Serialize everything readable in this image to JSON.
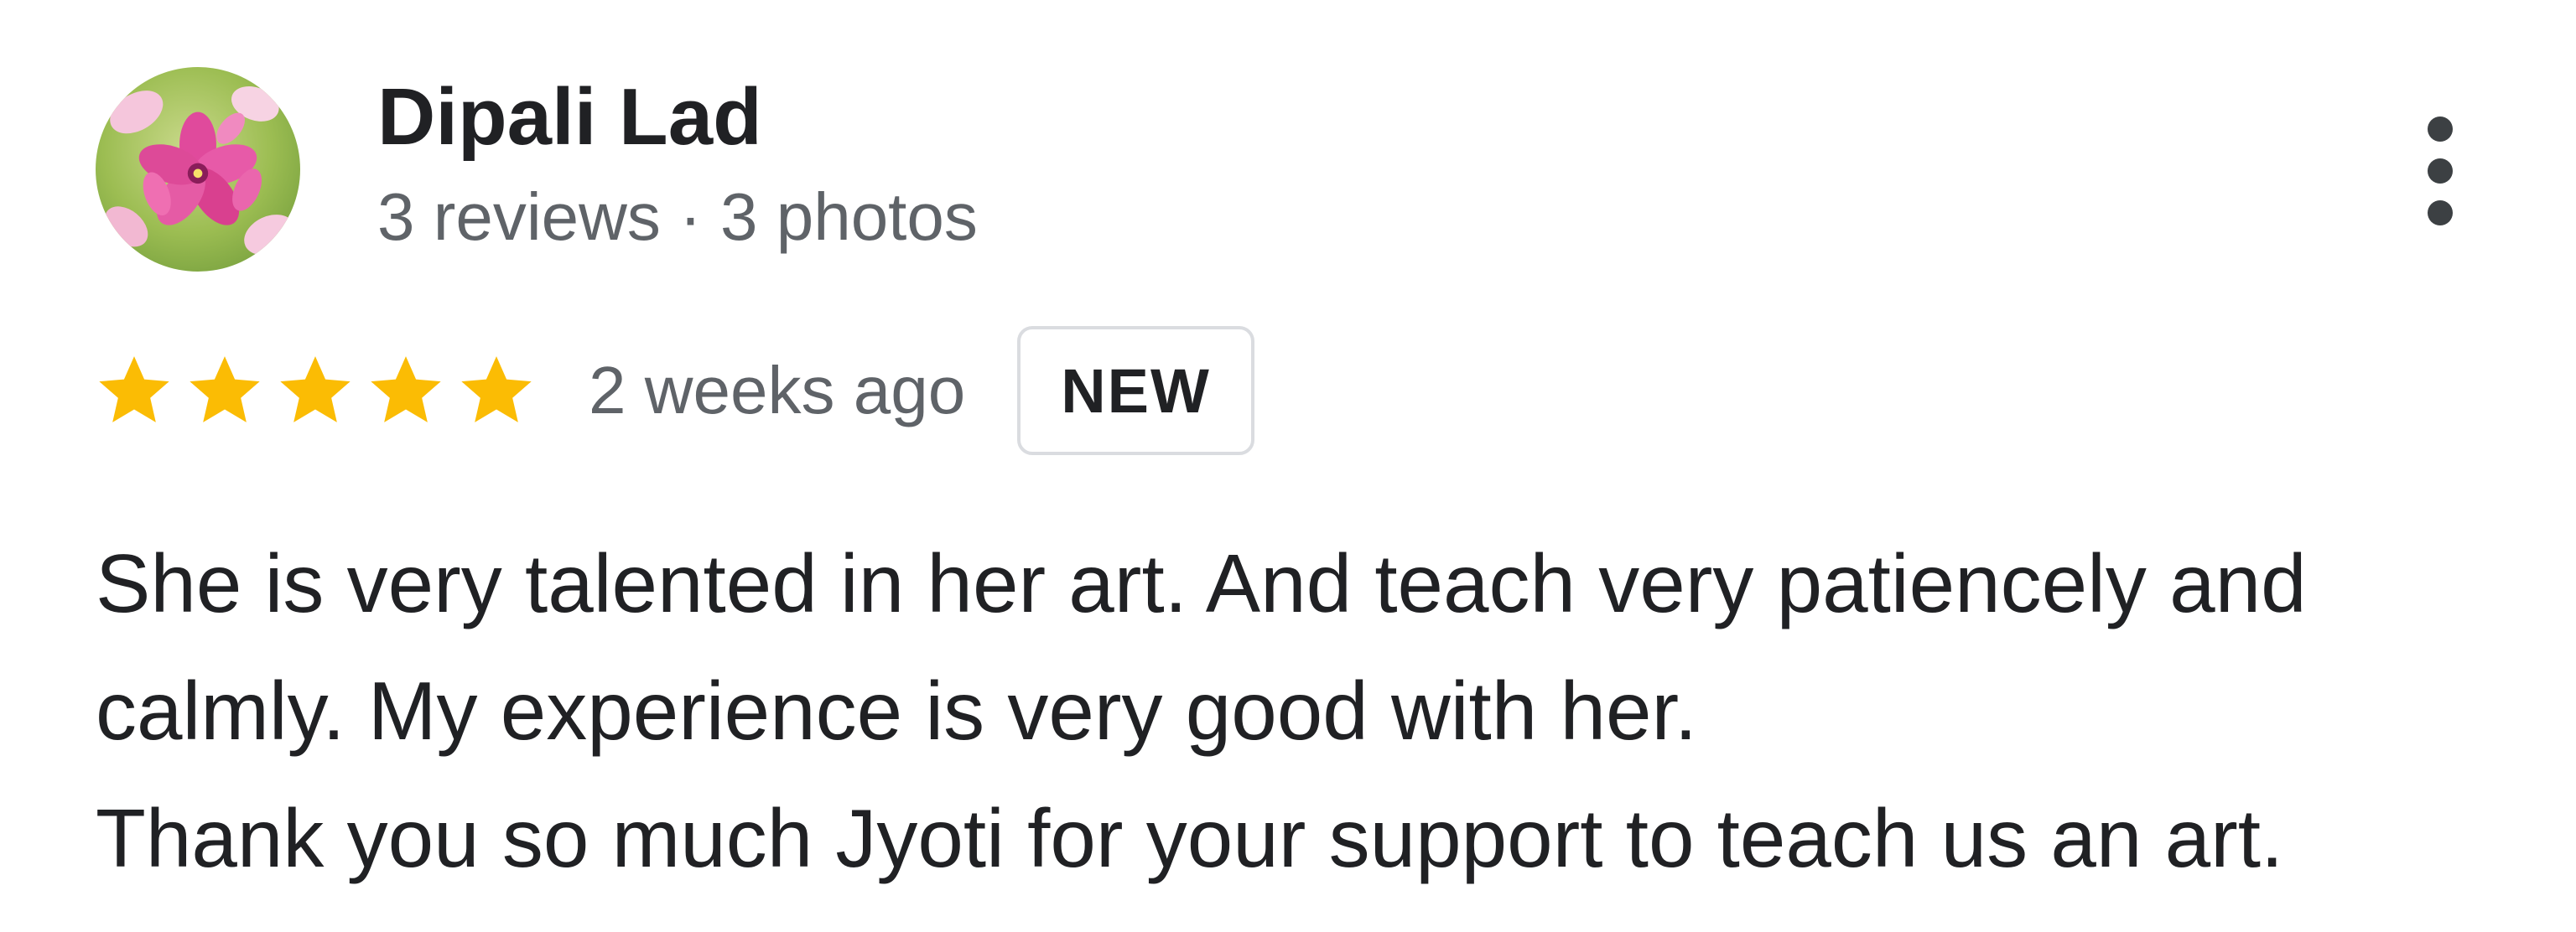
{
  "review": {
    "author": {
      "name": "Dipali Lad",
      "meta": "3 reviews · 3 photos",
      "avatar_icon": "flower-avatar-icon"
    },
    "more_icon": "more-vert-icon",
    "rating": {
      "stars": 5,
      "max_stars": 5,
      "star_color": "#fbbc04"
    },
    "time_ago": "2 weeks ago",
    "badge": "NEW",
    "text_lines": [
      "She is very talented in her art. And teach very patiencely and",
      "calmly. My experience is very good with her.",
      "Thank you so much Jyoti for your support to teach us an art."
    ]
  }
}
